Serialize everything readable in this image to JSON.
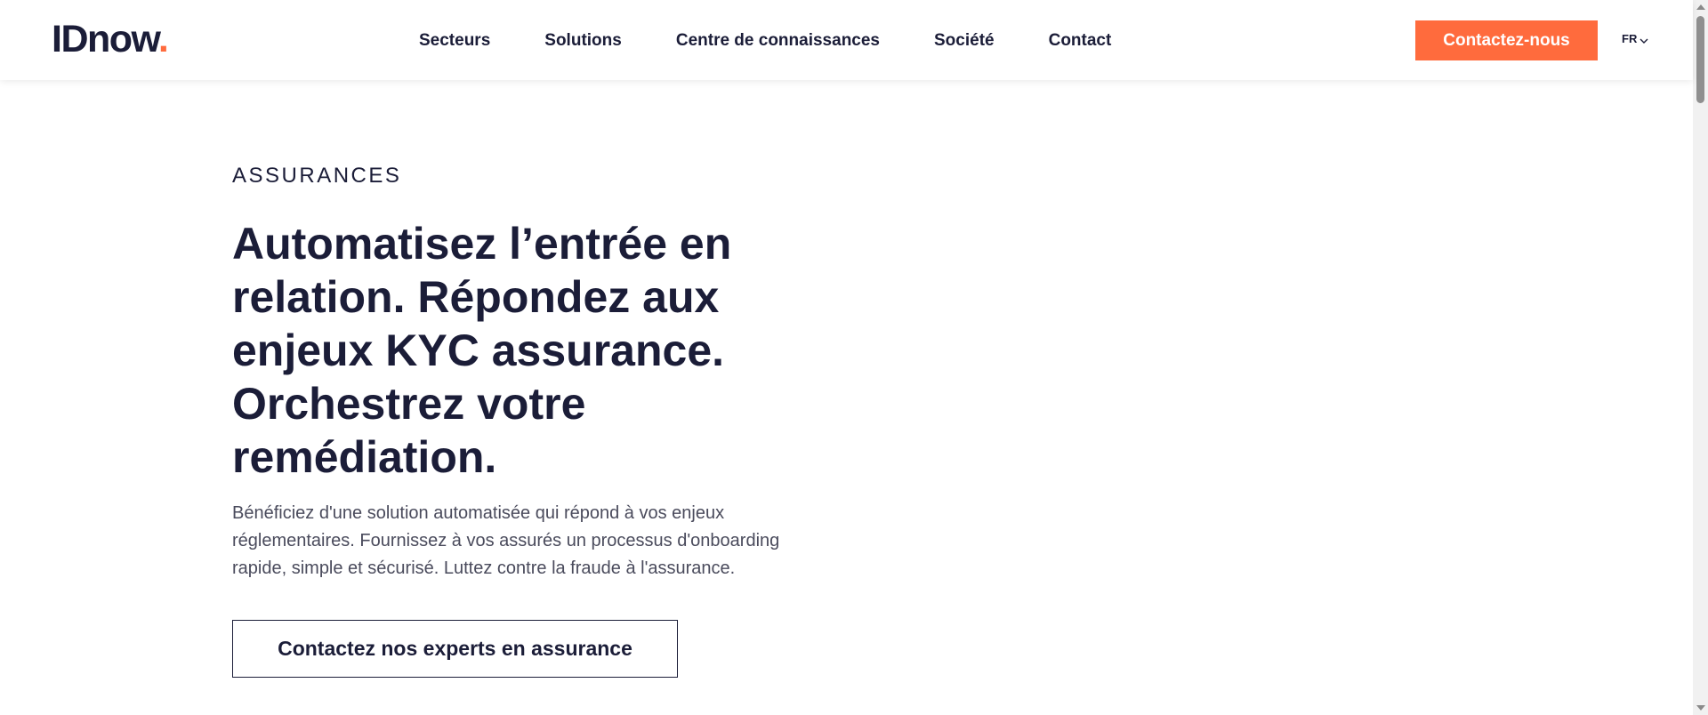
{
  "header": {
    "logo_text": "IDnow",
    "logo_dot": ".",
    "nav": [
      {
        "label": "Secteurs"
      },
      {
        "label": "Solutions"
      },
      {
        "label": "Centre de connaissances"
      },
      {
        "label": "Société"
      },
      {
        "label": "Contact"
      }
    ],
    "cta_label": "Contactez-nous",
    "language": "FR"
  },
  "hero": {
    "eyebrow": "ASSURANCES",
    "headline": "Automatisez l’entrée en relation. Répondez aux enjeux KYC assurance. Orchestrez votre remédiation.",
    "description": "Bénéficiez d'une solution automatisée qui répond à vos enjeux réglementaires. Fournissez à vos assurés un processus d'onboarding rapide, simple et sécurisé. Luttez contre la fraude à l'assurance.",
    "button_label": "Contactez nos experts en assurance"
  },
  "colors": {
    "brand_navy": "#1b1d38",
    "accent_orange": "#ff6b3d"
  }
}
